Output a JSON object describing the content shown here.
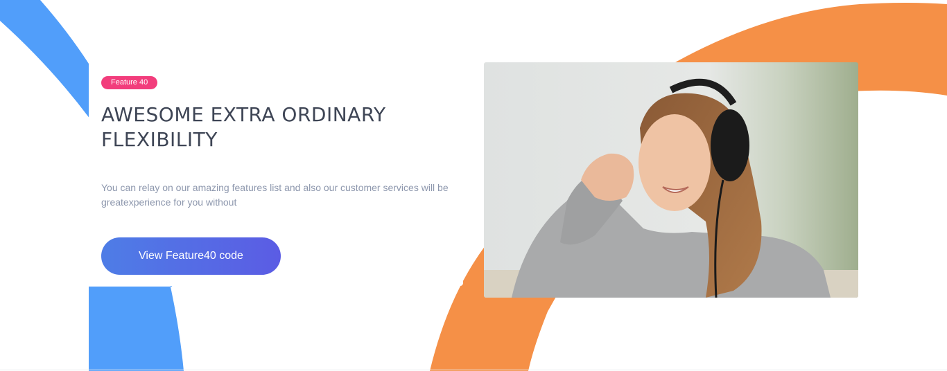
{
  "colors": {
    "blue_arc": "#519efa",
    "orange_arc": "#f59047",
    "badge": "#f23d7c",
    "button_start": "#4e7de6",
    "button_end": "#5b5ce4",
    "heading": "#3e4555",
    "body_text": "#8d97ad"
  },
  "feature": {
    "badge": "Feature 40",
    "title": "AWESOME EXTRA ORDINARY FLEXIBILITY",
    "description": "You can relay on our amazing features list and also our customer services will be greatexperience for you without",
    "button_label": "View Feature40 code"
  },
  "icons": {
    "photo": "woman-with-headphones-photo"
  }
}
